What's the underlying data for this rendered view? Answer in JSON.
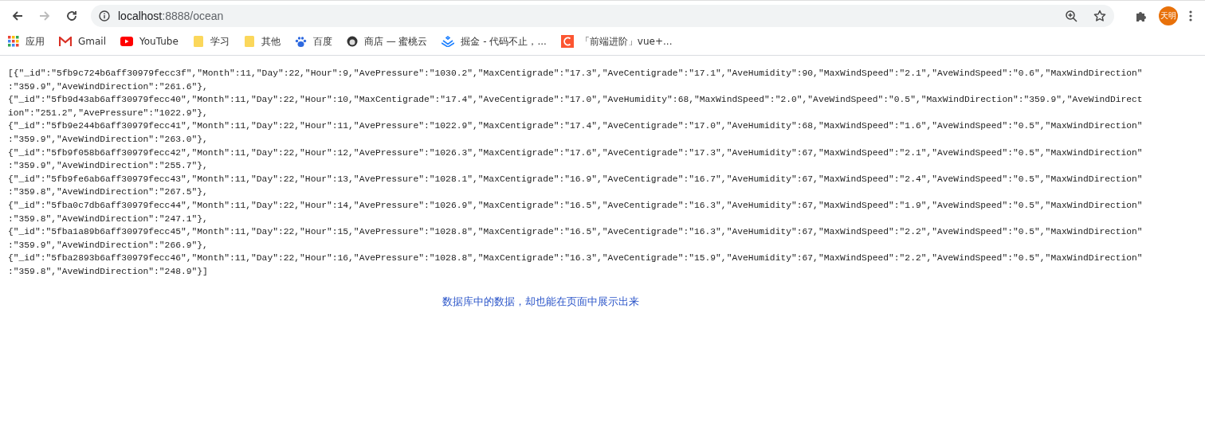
{
  "toolbar": {
    "back": {
      "disabled": false
    },
    "forward": {
      "disabled": true
    },
    "address": {
      "host": "localhost",
      "path": ":8888/ocean"
    },
    "profile": "天明"
  },
  "bookmarks": [
    {
      "kind": "apps",
      "label": "应用"
    },
    {
      "kind": "gmail",
      "label": "Gmail"
    },
    {
      "kind": "youtube",
      "label": "YouTube"
    },
    {
      "kind": "folder",
      "label": "学习"
    },
    {
      "kind": "folder",
      "label": "其他"
    },
    {
      "kind": "baidu",
      "label": "百度"
    },
    {
      "kind": "shop",
      "label": "商店 — 蜜桃云"
    },
    {
      "kind": "juejin",
      "label": "掘金 - 代码不止，..."
    },
    {
      "kind": "csdn",
      "label": "「前端进阶」vue+..."
    }
  ],
  "content": {
    "lines": [
      "[{\"_id\":\"5fb9c724b6aff30979fecc3f\",\"Month\":11,\"Day\":22,\"Hour\":9,\"AvePressure\":\"1030.2\",\"MaxCentigrade\":\"17.3\",\"AveCentigrade\":\"17.1\",\"AveHumidity\":90,\"MaxWindSpeed\":\"2.1\",\"AveWindSpeed\":\"0.6\",\"MaxWindDirection\"",
      ":\"359.9\",\"AveWindDirection\":\"261.6\"},",
      "{\"_id\":\"5fb9d43ab6aff30979fecc40\",\"Month\":11,\"Day\":22,\"Hour\":10,\"MaxCentigrade\":\"17.4\",\"AveCentigrade\":\"17.0\",\"AveHumidity\":68,\"MaxWindSpeed\":\"2.0\",\"AveWindSpeed\":\"0.5\",\"MaxWindDirection\":\"359.9\",\"AveWindDirect",
      "ion\":\"251.2\",\"AvePressure\":\"1022.9\"},",
      "{\"_id\":\"5fb9e244b6aff30979fecc41\",\"Month\":11,\"Day\":22,\"Hour\":11,\"AvePressure\":\"1022.9\",\"MaxCentigrade\":\"17.4\",\"AveCentigrade\":\"17.0\",\"AveHumidity\":68,\"MaxWindSpeed\":\"1.6\",\"AveWindSpeed\":\"0.5\",\"MaxWindDirection\"",
      ":\"359.9\",\"AveWindDirection\":\"263.0\"},",
      "{\"_id\":\"5fb9f058b6aff30979fecc42\",\"Month\":11,\"Day\":22,\"Hour\":12,\"AvePressure\":\"1026.3\",\"MaxCentigrade\":\"17.6\",\"AveCentigrade\":\"17.3\",\"AveHumidity\":67,\"MaxWindSpeed\":\"2.1\",\"AveWindSpeed\":\"0.5\",\"MaxWindDirection\"",
      ":\"359.9\",\"AveWindDirection\":\"255.7\"},",
      "{\"_id\":\"5fb9fe6ab6aff30979fecc43\",\"Month\":11,\"Day\":22,\"Hour\":13,\"AvePressure\":\"1028.1\",\"MaxCentigrade\":\"16.9\",\"AveCentigrade\":\"16.7\",\"AveHumidity\":67,\"MaxWindSpeed\":\"2.4\",\"AveWindSpeed\":\"0.5\",\"MaxWindDirection\"",
      ":\"359.8\",\"AveWindDirection\":\"267.5\"},",
      "{\"_id\":\"5fba0c7db6aff30979fecc44\",\"Month\":11,\"Day\":22,\"Hour\":14,\"AvePressure\":\"1026.9\",\"MaxCentigrade\":\"16.5\",\"AveCentigrade\":\"16.3\",\"AveHumidity\":67,\"MaxWindSpeed\":\"1.9\",\"AveWindSpeed\":\"0.5\",\"MaxWindDirection\"",
      ":\"359.8\",\"AveWindDirection\":\"247.1\"},",
      "{\"_id\":\"5fba1a89b6aff30979fecc45\",\"Month\":11,\"Day\":22,\"Hour\":15,\"AvePressure\":\"1028.8\",\"MaxCentigrade\":\"16.5\",\"AveCentigrade\":\"16.3\",\"AveHumidity\":67,\"MaxWindSpeed\":\"2.2\",\"AveWindSpeed\":\"0.5\",\"MaxWindDirection\"",
      ":\"359.9\",\"AveWindDirection\":\"266.9\"},",
      "{\"_id\":\"5fba2893b6aff30979fecc46\",\"Month\":11,\"Day\":22,\"Hour\":16,\"AvePressure\":\"1028.8\",\"MaxCentigrade\":\"16.3\",\"AveCentigrade\":\"15.9\",\"AveHumidity\":67,\"MaxWindSpeed\":\"2.2\",\"AveWindSpeed\":\"0.5\",\"MaxWindDirection\"",
      ":\"359.8\",\"AveWindDirection\":\"248.9\"}]"
    ],
    "caption": "数据库中的数据，却也能在页面中展示出来"
  }
}
